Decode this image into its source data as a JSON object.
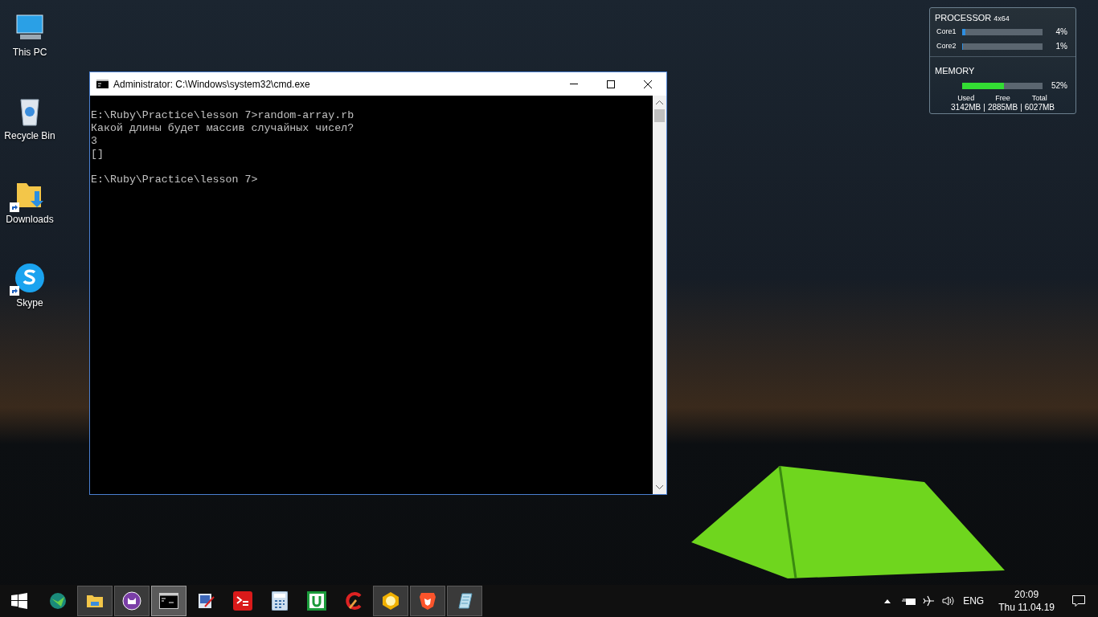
{
  "desktop_icons": [
    {
      "label": "This PC",
      "shortcut": false
    },
    {
      "label": "Recycle Bin",
      "shortcut": false
    },
    {
      "label": "Downloads",
      "shortcut": true
    },
    {
      "label": "Skype",
      "shortcut": true
    }
  ],
  "cmd_window": {
    "title": "Administrator: C:\\Windows\\system32\\cmd.exe",
    "blocks": [
      [
        "E:\\Ruby\\Practice\\lesson 7>random-array.rb",
        "Какой длины будет массив случайных чисел?",
        "3",
        "[]"
      ],
      [
        "E:\\Ruby\\Practice\\lesson 7>"
      ]
    ]
  },
  "gadget": {
    "processor_title": "PROCESSOR",
    "processor_type": "4x64",
    "cores": [
      {
        "name": "Core1",
        "level": 0.04,
        "reading": "4%"
      },
      {
        "name": "Core2",
        "level": 0.01,
        "reading": "1%"
      }
    ],
    "memory_title": "MEMORY",
    "memory": {
      "level": 0.52,
      "reading": "52%"
    },
    "stats": [
      {
        "label": "Used",
        "value": "3142MB"
      },
      {
        "label": "Free",
        "value": "2885MB"
      },
      {
        "label": "Total",
        "value": "6027MB"
      }
    ],
    "separator": "|"
  },
  "taskbar": {
    "apps": [
      {
        "running": false,
        "selected": false
      },
      {
        "running": true,
        "selected": false
      },
      {
        "running": true,
        "selected": false
      },
      {
        "running": true,
        "selected": true
      },
      {
        "running": false,
        "selected": false
      },
      {
        "running": false,
        "selected": false
      },
      {
        "running": false,
        "selected": false
      },
      {
        "running": false,
        "selected": false
      },
      {
        "running": false,
        "selected": false
      },
      {
        "running": true,
        "selected": false
      },
      {
        "running": true,
        "selected": false
      },
      {
        "running": true,
        "selected": false
      }
    ],
    "language": "ENG",
    "time": "20:09",
    "date": "Thu 11.04.19"
  }
}
